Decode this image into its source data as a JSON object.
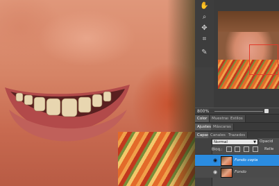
{
  "navigator": {
    "zoom": "800%"
  },
  "panel_tabs_1": [
    "Color",
    "Muestras",
    "Estilos"
  ],
  "panel_tabs_2": [
    "Ajustes",
    "Máscaras"
  ],
  "layers_tabs": [
    "Capas",
    "Canales",
    "Trazados"
  ],
  "layers": {
    "blend_mode": "Normal",
    "opacity_label": "Opacid",
    "lock_label": "Bloq.:",
    "fill_label": "Relle",
    "items": [
      {
        "name": "Fondo copia",
        "selected": true
      },
      {
        "name": "Fondo",
        "selected": false
      }
    ]
  },
  "colors": {
    "selection": "#2b8ce0",
    "panel_bg": "#474747",
    "nav_box": "#e23a2a"
  },
  "tools": [
    "hand-icon",
    "zoom-icon",
    "move-icon",
    "crop-icon",
    "brush-icon",
    "history-brush-icon"
  ]
}
